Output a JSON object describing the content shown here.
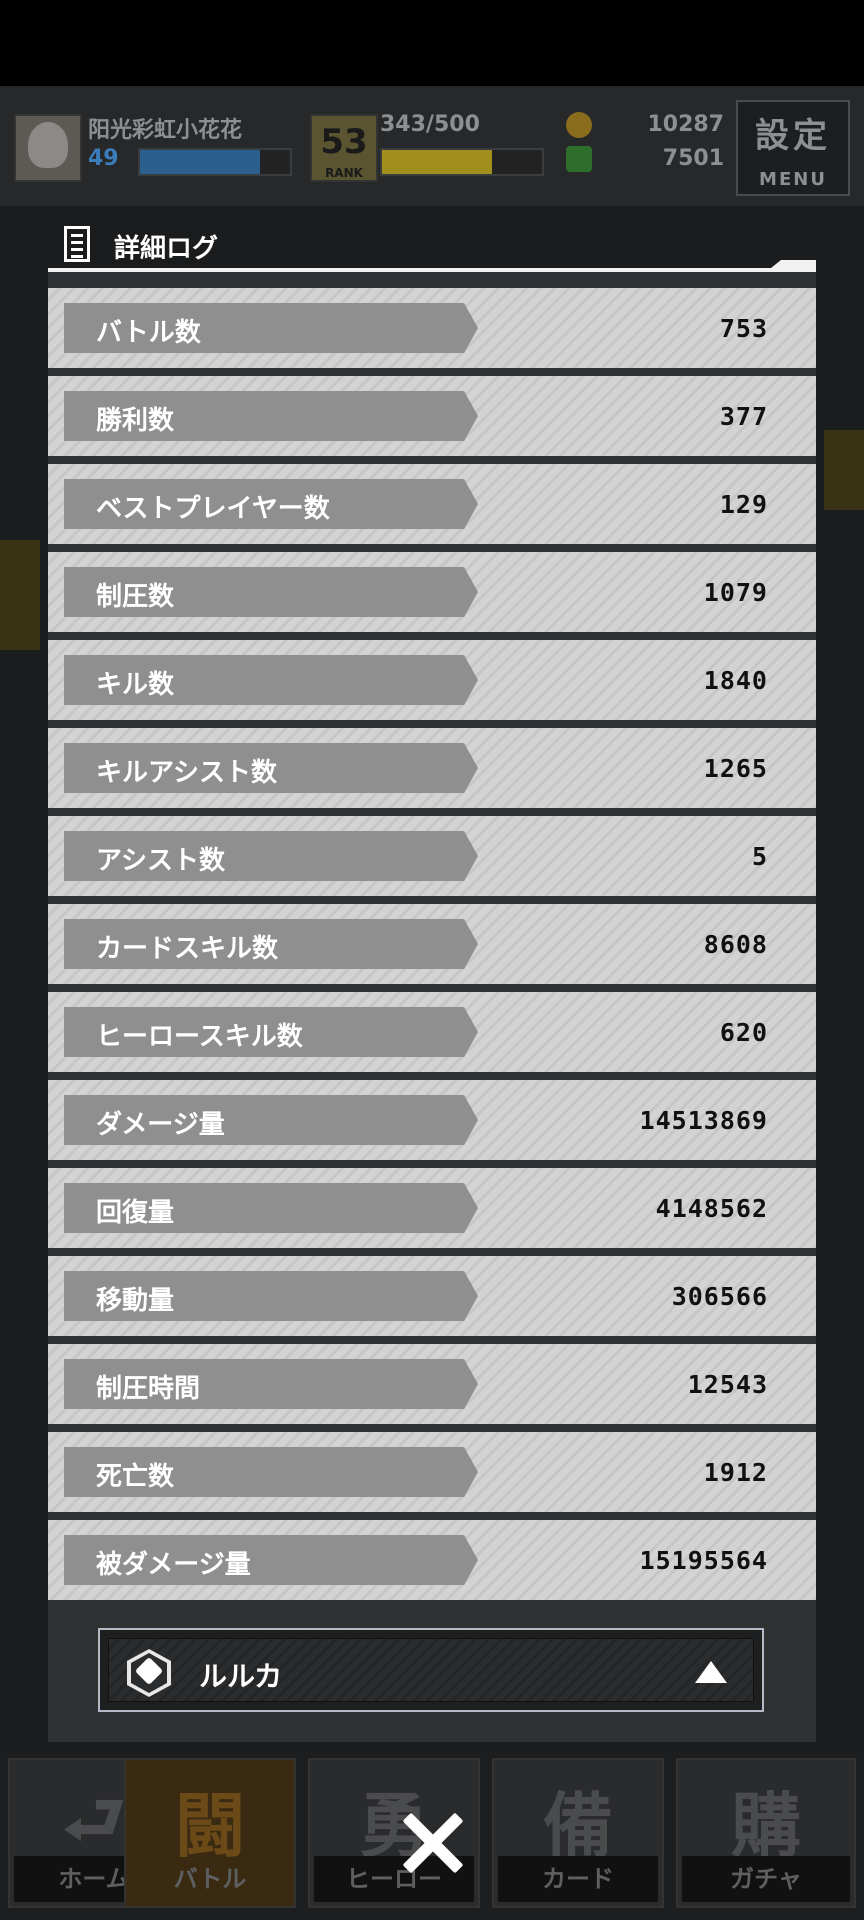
{
  "header": {
    "player_name": "阳光彩虹小花花",
    "level": "49",
    "xp_fraction": 0.8,
    "rank": "53",
    "rank_label": "RANK",
    "stamina": "343/500",
    "stamina_fraction": 0.686,
    "currency_gold": "10287",
    "currency_green": "7501",
    "menu_kanji": "設定",
    "menu_label": "MENU"
  },
  "panel": {
    "title": "詳細ログ",
    "rows": [
      {
        "label": "バトル数",
        "value": "753"
      },
      {
        "label": "勝利数",
        "value": "377"
      },
      {
        "label": "ベストプレイヤー数",
        "value": "129"
      },
      {
        "label": "制圧数",
        "value": "1079"
      },
      {
        "label": "キル数",
        "value": "1840"
      },
      {
        "label": "キルアシスト数",
        "value": "1265"
      },
      {
        "label": "アシスト数",
        "value": "5"
      },
      {
        "label": "カードスキル数",
        "value": "8608"
      },
      {
        "label": "ヒーロースキル数",
        "value": "620"
      },
      {
        "label": "ダメージ量",
        "value": "14513869"
      },
      {
        "label": "回復量",
        "value": "4148562"
      },
      {
        "label": "移動量",
        "value": "306566"
      },
      {
        "label": "制圧時間",
        "value": "12543"
      },
      {
        "label": "死亡数",
        "value": "1912"
      },
      {
        "label": "被ダメージ量",
        "value": "15195564"
      }
    ],
    "hero_selector": {
      "label": "ルルカ",
      "icon": "hero-class-hex-icon",
      "arrow": "chevron-up-icon"
    }
  },
  "bottom_nav": [
    {
      "label": "ホーム",
      "glyph": "⮐",
      "icon": "home-return-icon",
      "active": false
    },
    {
      "label": "バトル",
      "glyph": "闘",
      "icon": "gamepad-icon",
      "active": true
    },
    {
      "label": "ヒーロー",
      "glyph": "勇",
      "icon": "hero-icon",
      "active": false
    },
    {
      "label": "カード",
      "glyph": "備",
      "icon": "card-icon",
      "active": false
    },
    {
      "label": "ガチャ",
      "glyph": "購",
      "icon": "gacha-icon",
      "active": false
    }
  ],
  "close_icon": "close-icon",
  "colors": {
    "row_bg": "#d3d3d3",
    "row_tab": "#8f8f8f",
    "panel_bg": "#2f3133",
    "overlay_bg": "#1b1c1d"
  }
}
